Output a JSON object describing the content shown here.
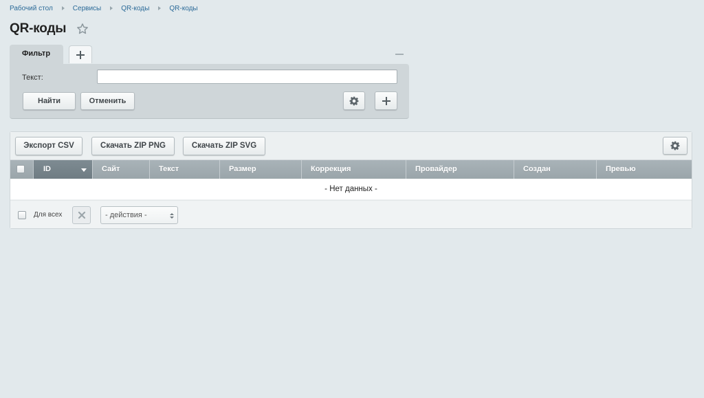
{
  "breadcrumb": [
    "Рабочий стол",
    "Сервисы",
    "QR-коды",
    "QR-коды"
  ],
  "page": {
    "title": "QR-коды"
  },
  "filter": {
    "tab_label": "Фильтр",
    "text_label": "Текст:",
    "text_value": "",
    "find_label": "Найти",
    "cancel_label": "Отменить"
  },
  "toolbar": {
    "export_csv": "Экспорт CSV",
    "download_png": "Скачать ZIP PNG",
    "download_svg": "Скачать ZIP SVG"
  },
  "grid": {
    "columns": [
      "ID",
      "Сайт",
      "Текст",
      "Размер",
      "Коррекция",
      "Провайдер",
      "Создан",
      "Превью"
    ],
    "sorted_column": "ID",
    "empty_text": "- Нет данных -",
    "rows": []
  },
  "footer": {
    "for_all_label": "Для всех",
    "actions_value": "- действия -"
  },
  "colors": {
    "link": "#2b6a98",
    "header_bg": "#9aa5aa",
    "page_bg": "#e2e9ec"
  },
  "icons": [
    "star-icon",
    "plus-icon",
    "minimize-icon",
    "gear-icon",
    "sort-down-icon",
    "close-icon",
    "updown-icon"
  ]
}
